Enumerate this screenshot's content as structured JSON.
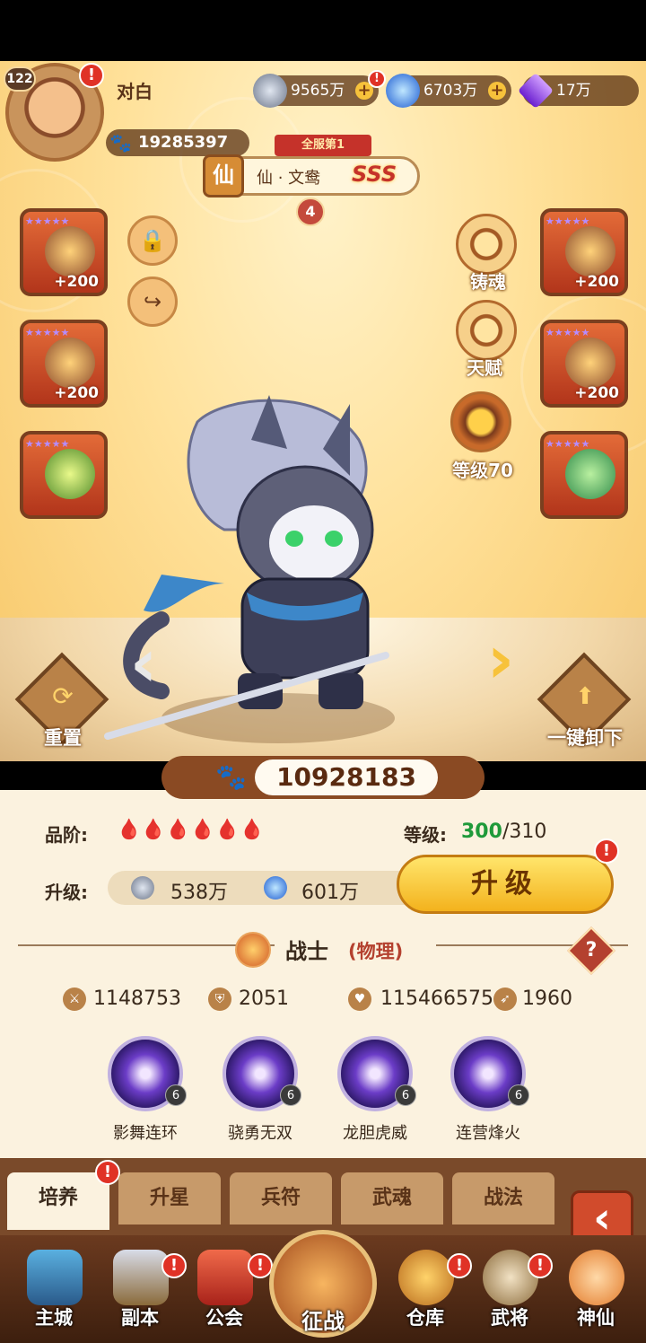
{
  "header": {
    "player_level": "122",
    "player_name": "对白",
    "power": "19285397",
    "resources": [
      {
        "name": "silver-coin",
        "value": "9565万"
      },
      {
        "name": "blue-gem",
        "value": "6703万"
      },
      {
        "name": "purple-crystal",
        "value": "17万"
      }
    ],
    "alert": "!"
  },
  "hero": {
    "rank_banner": "全服第1",
    "class_badge": "仙",
    "name": "仙 · 文鸯",
    "grade": "SSS",
    "star": "4",
    "power": "10928183"
  },
  "slots": {
    "bonus": "+200"
  },
  "features": {
    "soul_cast": "铸魂",
    "talent": "天赋",
    "level": "等级70",
    "reset": "重置",
    "unequip_all": "一键卸下"
  },
  "info": {
    "quality_label": "品阶:",
    "quality_drops": "🩸🩸🩸🩸🩸🩸",
    "level_label": "等级:",
    "level_current": "300",
    "level_max": "/310",
    "upgrade_label": "升级:",
    "cost_silver": "538万",
    "cost_gem": "601万",
    "upgrade_button": "升级",
    "class_name": "战士",
    "class_type": "(物理)",
    "help": "?",
    "stats": {
      "attack": "1148753",
      "defense": "2051",
      "hp": "115466575",
      "speed": "1960"
    },
    "skills": [
      {
        "name": "影舞连环",
        "level": "6"
      },
      {
        "name": "骁勇无双",
        "level": "6"
      },
      {
        "name": "龙胆虎威",
        "level": "6"
      },
      {
        "name": "连营烽火",
        "level": "6"
      }
    ]
  },
  "tabs": [
    "培养",
    "升星",
    "兵符",
    "武魂",
    "战法"
  ],
  "bottom_nav": {
    "items": [
      "主城",
      "副本",
      "公会",
      "征战",
      "仓库",
      "武将",
      "神仙"
    ]
  },
  "colors": {
    "accent_red": "#c5322a",
    "level_green": "#1f9a3a",
    "gold": "#f3b21d"
  }
}
